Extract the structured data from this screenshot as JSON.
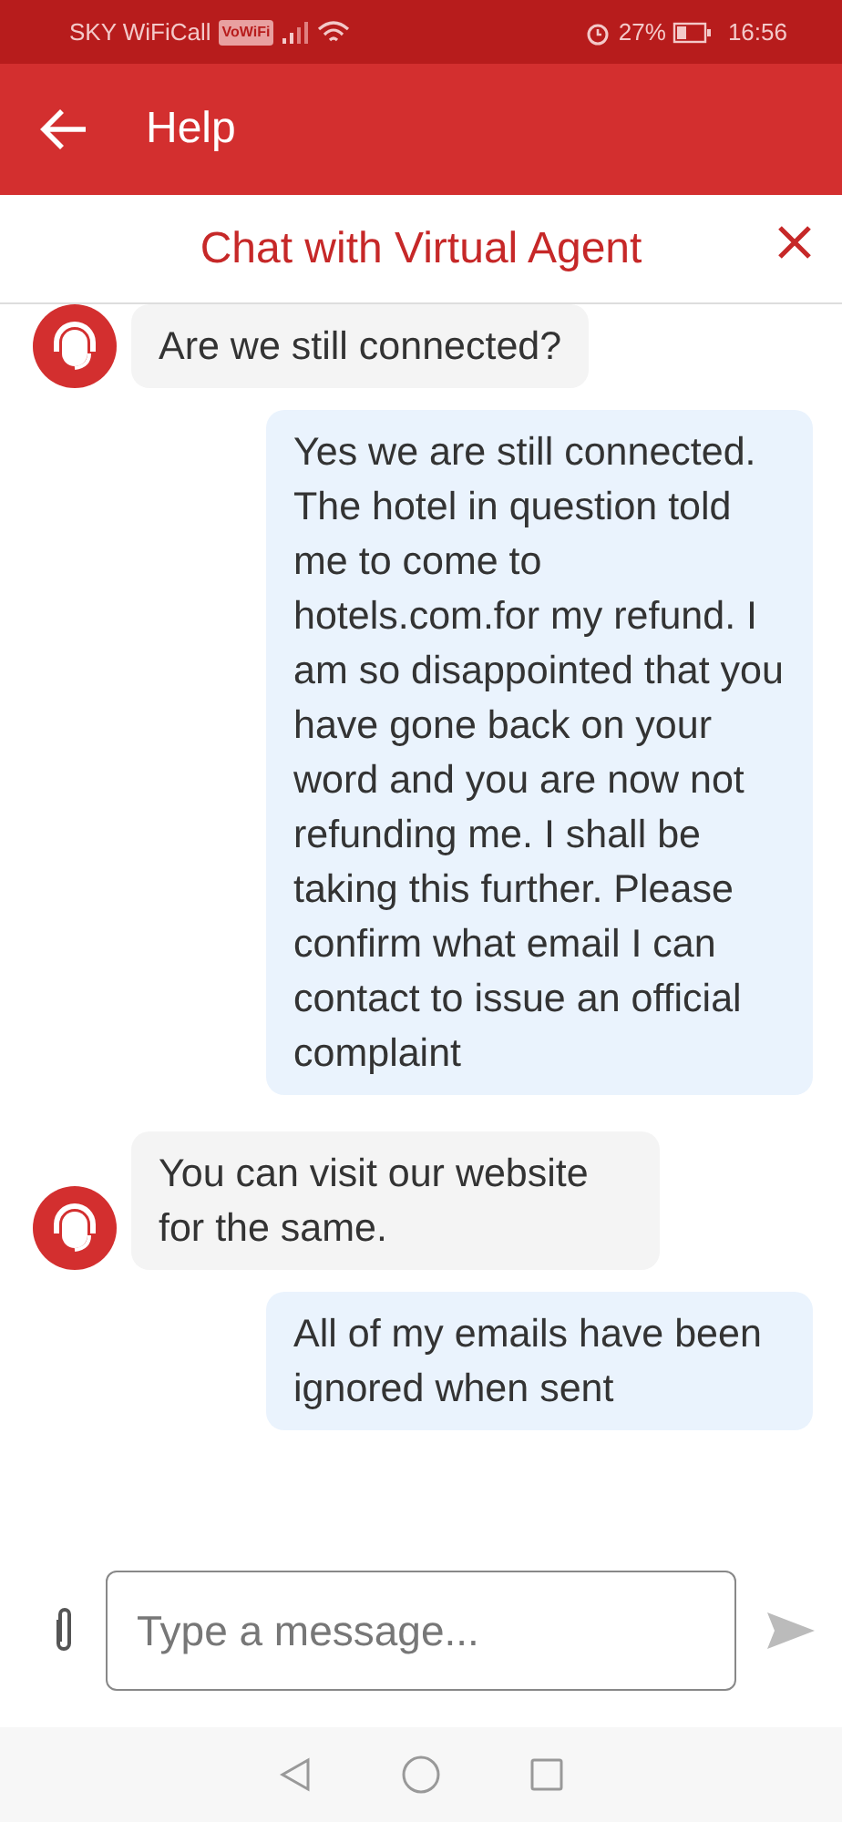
{
  "status_bar": {
    "carrier": "SKY WiFiCall",
    "wifi_call_badge": "VoWiFi",
    "battery_text": "27%",
    "time": "16:56"
  },
  "app_bar": {
    "title": "Help"
  },
  "chat_header": {
    "title": "Chat with Virtual Agent"
  },
  "messages": [
    {
      "kind": "agent",
      "text": "Are we still connected?"
    },
    {
      "kind": "user",
      "text": "Yes we are still connected. The hotel in question told me to come to hotels.com.for my refund. I am so disappointed that you have gone back on your word and you are now not refunding me. I shall be taking this further. Please confirm what email I can contact to issue an official complaint"
    },
    {
      "kind": "agent",
      "text": "You can visit our website for the same."
    },
    {
      "kind": "user",
      "text": "All of my emails have been ignored when sent"
    }
  ],
  "composer": {
    "placeholder": "Type a message..."
  }
}
